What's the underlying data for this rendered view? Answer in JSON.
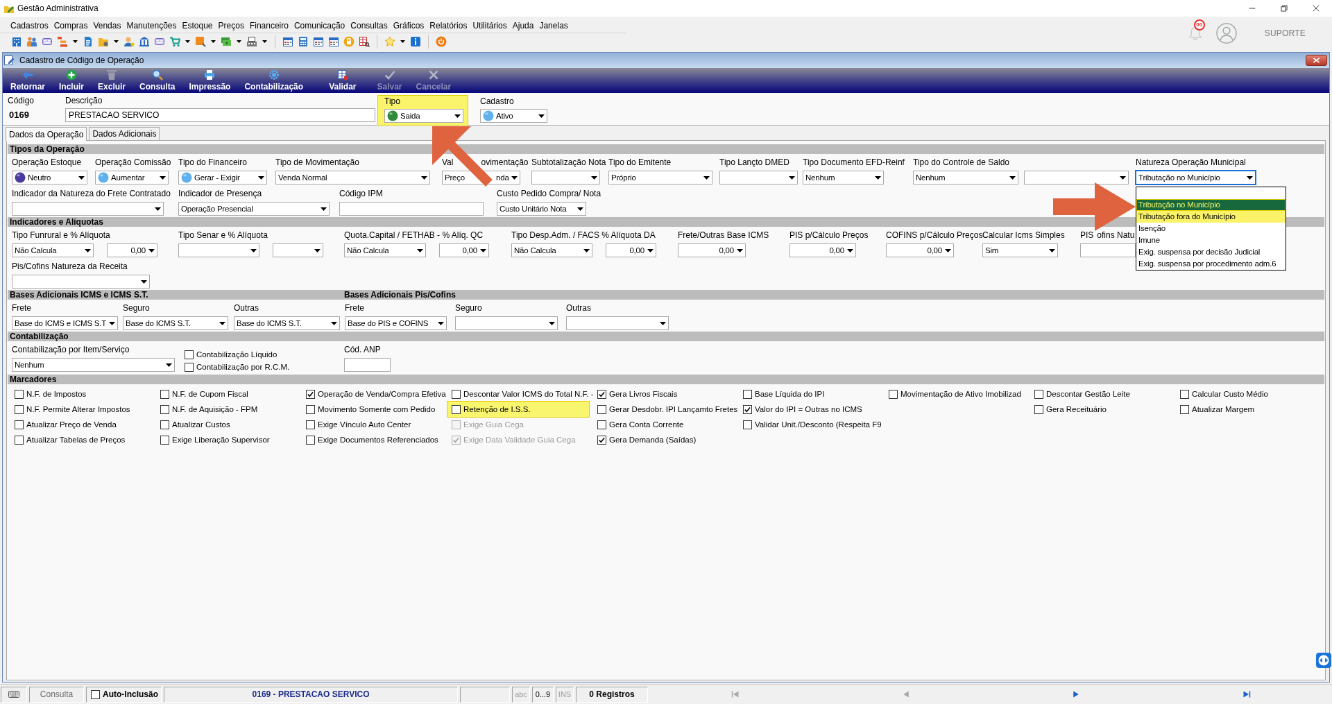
{
  "window": {
    "title": "Gestão Administrativa",
    "notification_count": "00",
    "user": "SUPORTE"
  },
  "menu": [
    "Cadastros",
    "Compras",
    "Vendas",
    "Manutenções",
    "Estoque",
    "Preços",
    "Financeiro",
    "Comunicação",
    "Consultas",
    "Gráficos",
    "Relatórios",
    "Utilitários",
    "Ajuda",
    "Janelas"
  ],
  "form": {
    "title": "Cadastro de Código de Operação",
    "toolbar": [
      {
        "label": "Retornar",
        "disabled": false
      },
      {
        "label": "Incluir",
        "disabled": false
      },
      {
        "label": "Excluir",
        "disabled": false
      },
      {
        "label": "Consulta",
        "disabled": false
      },
      {
        "label": "Impressão",
        "disabled": false
      },
      {
        "label": "Contabilização",
        "disabled": false
      },
      {
        "label": "Validar",
        "disabled": false
      },
      {
        "label": "Salvar",
        "disabled": true
      },
      {
        "label": "Cancelar",
        "disabled": true
      }
    ],
    "header": {
      "code": {
        "label": "Código",
        "value": "0169"
      },
      "description": {
        "label": "Descrição",
        "value": "PRESTACAO SERVICO"
      },
      "type": {
        "label": "Tipo",
        "value": "Saida",
        "color": "#2f8a3a",
        "highlighted": true,
        "arrow": true
      },
      "status": {
        "label": "Cadastro",
        "value": "Ativo",
        "color": "#5fb0ec"
      }
    },
    "tabs": [
      {
        "label": "Dados da Operação",
        "selected": true
      },
      {
        "label": "Dados Adicionais",
        "selected": false
      }
    ],
    "sections": [
      {
        "titles": [
          "Tipos da Operação"
        ],
        "kind": "fields",
        "rows": [
          {
            "fields": [
              {
                "label": "Operação Estoque",
                "inputs": [
                  {
                    "kind": "icon_combo",
                    "value": "Neutro",
                    "color": "#4b3a9c"
                  }
                ]
              },
              {
                "label": "Operação Comissão",
                "inputs": [
                  {
                    "kind": "icon_combo",
                    "value": "Aumentar",
                    "color": "#5fb0ec"
                  }
                ]
              },
              {
                "label": "Tipo do Financeiro",
                "inputs": [
                  {
                    "kind": "icon_combo",
                    "value": "Gerar - Exigir",
                    "color": "#5fb0ec"
                  }
                ]
              },
              {
                "label": "Tipo de Movimentação",
                "inputs": [
                  {
                    "kind": "combo",
                    "value": "Venda Normal"
                  }
                ]
              },
              {
                "label_parts": [
                  "Val",
                  "ovimentação"
                ],
                "inputs": [
                  {
                    "kind": "combo",
                    "value_parts": [
                      "Preço",
                      "nda"
                    ]
                  }
                ]
              },
              {
                "label": "Subtotalização Nota",
                "inputs": [
                  {
                    "kind": "combo"
                  }
                ]
              },
              {
                "label": "Tipo do Emitente",
                "inputs": [
                  {
                    "kind": "combo",
                    "value": "Próprio"
                  }
                ]
              },
              {
                "label": "Tipo Lançto DMED",
                "inputs": [
                  {
                    "kind": "combo"
                  }
                ]
              },
              {
                "label": "Tipo Documento EFD-Reinf",
                "inputs": [
                  {
                    "kind": "combo",
                    "value": "Nenhum"
                  }
                ]
              },
              {
                "label": "Tipo do Controle de Saldo",
                "inputs": [
                  {
                    "kind": "combo",
                    "value": "Nenhum"
                  },
                  {
                    "kind": "combo"
                  }
                ]
              },
              {
                "label": "Natureza Operação Municipal",
                "inputs": [
                  {
                    "kind": "combo",
                    "value": "Tributação no Município",
                    "focused": true,
                    "arrow": true,
                    "options": [
                      {
                        "label": "Tributação no Município",
                        "selected": true,
                        "highlighted": true
                      },
                      {
                        "label": "Tributação fora do Município",
                        "selected": false,
                        "highlighted": true
                      },
                      {
                        "label": "Isenção",
                        "selected": false,
                        "highlighted": false
                      },
                      {
                        "label": "Imune",
                        "selected": false,
                        "highlighted": false
                      },
                      {
                        "label": "Exig. suspensa por decisão Judicial",
                        "selected": false,
                        "highlighted": false
                      },
                      {
                        "label": "Exig. suspensa por procedimento adm.6",
                        "selected": false,
                        "highlighted": false
                      }
                    ]
                  }
                ]
              }
            ]
          },
          {
            "fields": [
              {
                "label": "Indicador da Natureza do Frete Contratado",
                "inputs": [
                  {
                    "kind": "combo"
                  }
                ]
              },
              {
                "label": "Indicador de Presença",
                "inputs": [
                  {
                    "kind": "combo",
                    "value": "Operação Presencial"
                  }
                ]
              },
              {
                "label": "Código IPM",
                "inputs": [
                  {
                    "kind": "text"
                  }
                ]
              },
              {
                "label": "Custo Pedido Compra/ Nota",
                "inputs": [
                  {
                    "kind": "combo",
                    "value": "Custo Unitário Nota"
                  }
                ]
              }
            ]
          }
        ]
      },
      {
        "titles": [
          "Indicadores e Alíquotas"
        ],
        "kind": "fields",
        "rows": [
          {
            "fields": [
              {
                "label": "Tipo Funrural e % Alíquota",
                "inputs": [
                  {
                    "kind": "combo",
                    "value": "Não Calcula"
                  },
                  {
                    "kind": "number_combo",
                    "value": "0,00"
                  }
                ]
              },
              {
                "label": "Tipo Senar e % Alíquota",
                "inputs": [
                  {
                    "kind": "combo"
                  },
                  {
                    "kind": "combo"
                  }
                ]
              },
              {
                "label": "Quota.Capital / FETHAB - % Alíq. QC",
                "inputs": [
                  {
                    "kind": "combo",
                    "value": "Não Calcula"
                  },
                  {
                    "kind": "number_combo",
                    "value": "0,00"
                  }
                ]
              },
              {
                "label": "Tipo Desp.Adm. / FACS % Alíquota DA",
                "inputs": [
                  {
                    "kind": "combo",
                    "value": "Não Calcula"
                  },
                  {
                    "kind": "number_combo",
                    "value": "0,00"
                  }
                ]
              },
              {
                "label": "Frete/Outras Base ICMS",
                "inputs": [
                  {
                    "kind": "number_combo",
                    "value": "0,00"
                  }
                ]
              },
              {
                "label": "PIS p/Cálculo Preços",
                "inputs": [
                  {
                    "kind": "number_combo",
                    "value": "0,00"
                  }
                ]
              },
              {
                "label": "COFINS p/Cálculo Preços",
                "inputs": [
                  {
                    "kind": "number_combo",
                    "value": "0,00"
                  }
                ]
              },
              {
                "label": "Calcular Icms Simples",
                "inputs": [
                  {
                    "kind": "combo",
                    "value": "Sim"
                  }
                ]
              },
              {
                "label_parts": [
                  "PIS",
                  "ofins Natu"
                ],
                "inputs": [
                  {
                    "kind": "text"
                  }
                ]
              }
            ]
          },
          {
            "fields": [
              {
                "label": "Pis/Cofins Natureza da Receita",
                "inputs": [
                  {
                    "kind": "combo"
                  }
                ]
              }
            ]
          }
        ]
      },
      {
        "titles": [
          "Bases Adicionais ICMS e ICMS S.T.",
          "Bases Adicionais Pis/Cofins"
        ],
        "kind": "fields",
        "rows": [
          {
            "fields": [
              {
                "label": "Frete",
                "inputs": [
                  {
                    "kind": "combo",
                    "value": "Base do ICMS e ICMS S.T"
                  }
                ]
              },
              {
                "label": "Seguro",
                "inputs": [
                  {
                    "kind": "combo",
                    "value": "Base do ICMS S.T."
                  }
                ]
              },
              {
                "label": "Outras",
                "inputs": [
                  {
                    "kind": "combo",
                    "value": "Base do ICMS S.T."
                  }
                ]
              },
              {
                "label": "Frete",
                "inputs": [
                  {
                    "kind": "combo",
                    "value": "Base do PIS e COFINS"
                  }
                ]
              },
              {
                "label": "Seguro",
                "inputs": [
                  {
                    "kind": "combo"
                  }
                ]
              },
              {
                "label": "Outras",
                "inputs": [
                  {
                    "kind": "combo"
                  }
                ]
              }
            ]
          }
        ]
      },
      {
        "titles": [
          "Contabilização"
        ],
        "kind": "fields",
        "rows": [
          {
            "fields": [
              {
                "kind": "field",
                "label": "Contabilização por Item/Serviço",
                "inputs": [
                  {
                    "kind": "combo",
                    "value": "Nenhum"
                  }
                ]
              },
              {
                "kind": "checks",
                "items": [
                  {
                    "label": "Contabilização Líquido",
                    "checked": false
                  },
                  {
                    "label": "Contabilização por R.C.M.",
                    "checked": false
                  }
                ]
              },
              {
                "kind": "field",
                "label": "Cód. ANP",
                "inputs": [
                  {
                    "kind": "text"
                  }
                ]
              }
            ]
          }
        ]
      },
      {
        "titles": [
          "Marcadores"
        ],
        "kind": "checkboxes",
        "columns": [
          {
            "items": [
              {
                "label": "N.F. de Impostos",
                "checked": false,
                "disabled": false,
                "highlighted": false
              },
              {
                "label": "N.F. Permite Alterar Impostos",
                "checked": false,
                "disabled": false,
                "highlighted": false
              },
              {
                "label": "Atualizar Preço de Venda",
                "checked": false,
                "disabled": false,
                "highlighted": false
              },
              {
                "label": "Atualizar Tabelas de Preços",
                "checked": false,
                "disabled": false,
                "highlighted": false
              }
            ]
          },
          {
            "items": [
              {
                "label": "N.F. de Cupom Fiscal",
                "checked": false,
                "disabled": false,
                "highlighted": false
              },
              {
                "label": "N.F. de Aquisição - FPM",
                "checked": false,
                "disabled": false,
                "highlighted": false
              },
              {
                "label": "Atualizar Custos",
                "checked": false,
                "disabled": false,
                "highlighted": false
              },
              {
                "label": "Exige Liberação Supervisor",
                "checked": false,
                "disabled": false,
                "highlighted": false
              }
            ]
          },
          {
            "items": [
              {
                "label": "Operação de Venda/Compra Efetiva",
                "checked": true,
                "disabled": false,
                "highlighted": false
              },
              {
                "label": "Movimento Somente com Pedido",
                "checked": false,
                "disabled": false,
                "highlighted": false
              },
              {
                "label": "Exige Vínculo Auto Center",
                "checked": false,
                "disabled": false,
                "highlighted": false
              },
              {
                "label": "Exige Documentos Referenciados",
                "checked": false,
                "disabled": false,
                "highlighted": false
              }
            ]
          },
          {
            "items": [
              {
                "label": "Descontar Valor ICMS do Total N.F. -",
                "checked": false,
                "disabled": false,
                "highlighted": false
              },
              {
                "label": "Retenção de I.S.S.",
                "checked": false,
                "disabled": false,
                "highlighted": true
              },
              {
                "label": "Exige Guia Cega",
                "checked": false,
                "disabled": true,
                "highlighted": false
              },
              {
                "label": "Exige Data Validade Guia Cega",
                "checked": true,
                "disabled": true,
                "highlighted": false
              }
            ]
          },
          {
            "items": [
              {
                "label": "Gera Livros Fiscais",
                "checked": true,
                "disabled": false,
                "highlighted": false
              },
              {
                "label": "Gerar Desdobr. IPI Lançamto Fretes",
                "checked": false,
                "disabled": false,
                "highlighted": false
              },
              {
                "label": "Gera Conta Corrente",
                "checked": false,
                "disabled": false,
                "highlighted": false
              },
              {
                "label": "Gera Demanda (Saídas)",
                "checked": true,
                "disabled": false,
                "highlighted": false
              }
            ]
          },
          {
            "items": [
              {
                "label": "Base Líquida do IPI",
                "checked": false,
                "disabled": false,
                "highlighted": false
              },
              {
                "label": "Valor do IPI = Outras no ICMS",
                "checked": true,
                "disabled": false,
                "highlighted": false
              },
              {
                "label": "Validar Unit./Desconto (Respeita F9",
                "checked": false,
                "disabled": false,
                "highlighted": false
              }
            ]
          },
          {
            "items": [
              {
                "label": "Movimentação de Ativo Imobilizad",
                "checked": false,
                "disabled": false,
                "highlighted": false
              }
            ]
          },
          {
            "items": [
              {
                "label": "Descontar Gestão Leite",
                "checked": false,
                "disabled": false,
                "highlighted": false
              },
              {
                "label": "Gera Receituário",
                "checked": false,
                "disabled": false,
                "highlighted": false
              }
            ]
          },
          {
            "items": [
              {
                "label": "Calcular Custo Médio",
                "checked": false,
                "disabled": false,
                "highlighted": false
              },
              {
                "label": "Atualizar Margem",
                "checked": false,
                "disabled": false,
                "highlighted": false
              }
            ]
          }
        ]
      }
    ]
  },
  "status_bar": {
    "mode": "Consulta",
    "auto_include": {
      "label": "Auto-Inclusão",
      "checked": false
    },
    "record": "0169 - PRESTACAO SERVICO",
    "indicators": [
      {
        "label": "abc",
        "active": false
      },
      {
        "label": "0...9",
        "active": true
      },
      {
        "label": "INS",
        "active": false
      }
    ],
    "record_count": "0 Registros",
    "navigation": [
      {
        "disabled": true
      },
      {
        "disabled": true
      },
      {
        "disabled": false
      },
      {
        "disabled": false
      }
    ]
  }
}
